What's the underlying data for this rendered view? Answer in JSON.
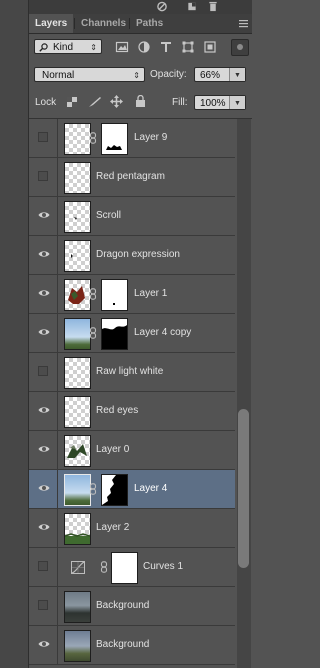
{
  "panel": {
    "tabs": [
      {
        "label": "Layers",
        "active": true
      },
      {
        "label": "Channels",
        "active": false
      },
      {
        "label": "Paths",
        "active": false
      }
    ]
  },
  "filter": {
    "label": "Kind",
    "icon": "search-icon"
  },
  "blend": {
    "mode": "Normal",
    "opacity_label": "Opacity:",
    "opacity_value": "66%"
  },
  "lock": {
    "label": "Lock",
    "fill_label": "Fill:",
    "fill_value": "100%"
  },
  "layers": [
    {
      "name": "Layer 9",
      "visible": false,
      "mask": true,
      "thumb": "checker"
    },
    {
      "name": "Red pentagram",
      "visible": false,
      "mask": false,
      "thumb": "checker"
    },
    {
      "name": "Scroll",
      "visible": true,
      "mask": false,
      "thumb": "checker"
    },
    {
      "name": "Dragon expression",
      "visible": true,
      "mask": false,
      "thumb": "checker"
    },
    {
      "name": "Layer 1",
      "visible": true,
      "mask": true,
      "thumb": "checker"
    },
    {
      "name": "Layer 4 copy",
      "visible": true,
      "mask": true,
      "thumb": "sky"
    },
    {
      "name": "Raw light white",
      "visible": false,
      "mask": false,
      "thumb": "checker"
    },
    {
      "name": "Red eyes",
      "visible": true,
      "mask": false,
      "thumb": "checker"
    },
    {
      "name": "Layer 0",
      "visible": true,
      "mask": false,
      "thumb": "checker"
    },
    {
      "name": "Layer 4",
      "visible": true,
      "mask": true,
      "thumb": "sky",
      "selected": true
    },
    {
      "name": "Layer 2",
      "visible": true,
      "mask": false,
      "thumb": "checker"
    },
    {
      "name": "Curves 1",
      "visible": false,
      "mask": true,
      "thumb": "adjustment"
    },
    {
      "name": "Background",
      "visible": false,
      "mask": false,
      "thumb": "bg1"
    },
    {
      "name": "Background",
      "visible": true,
      "mask": false,
      "thumb": "bg2"
    }
  ],
  "colors": {
    "selected_row": "#5d6f86",
    "panel_bg": "#535353"
  }
}
